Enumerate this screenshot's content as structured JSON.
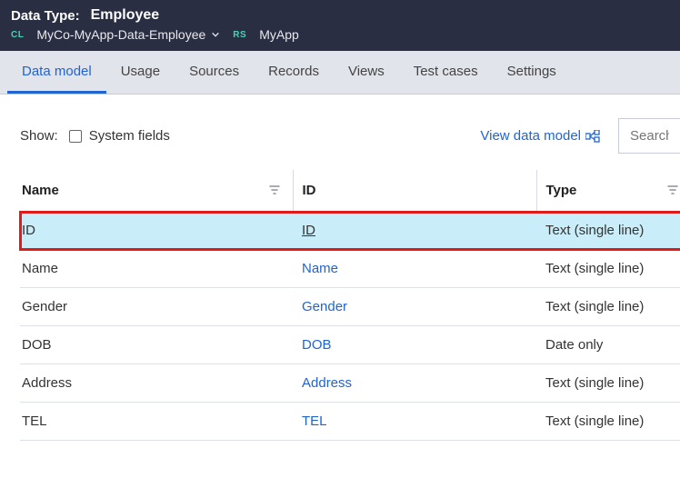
{
  "header": {
    "data_type_label": "Data Type:",
    "data_type_value": "Employee",
    "cl_badge": "CL",
    "class_name": "MyCo-MyApp-Data-Employee",
    "rs_badge": "RS",
    "ruleset_name": "MyApp"
  },
  "tabs": [
    {
      "label": "Data model",
      "active": true
    },
    {
      "label": "Usage"
    },
    {
      "label": "Sources"
    },
    {
      "label": "Records"
    },
    {
      "label": "Views"
    },
    {
      "label": "Test cases"
    },
    {
      "label": "Settings"
    }
  ],
  "toolbar": {
    "show_label": "Show:",
    "system_fields_label": "System fields",
    "view_data_model_label": "View data model",
    "search_placeholder": "Search..."
  },
  "table": {
    "headers": {
      "name": "Name",
      "id": "ID",
      "type": "Type"
    },
    "rows": [
      {
        "name": "ID",
        "id": "ID",
        "type": "Text (single line)",
        "selected": true
      },
      {
        "name": "Name",
        "id": "Name",
        "type": "Text (single line)"
      },
      {
        "name": "Gender",
        "id": "Gender",
        "type": "Text (single line)"
      },
      {
        "name": "DOB",
        "id": "DOB",
        "type": "Date only"
      },
      {
        "name": "Address",
        "id": "Address",
        "type": "Text (single line)"
      },
      {
        "name": "TEL",
        "id": "TEL",
        "type": "Text (single line)"
      }
    ]
  }
}
